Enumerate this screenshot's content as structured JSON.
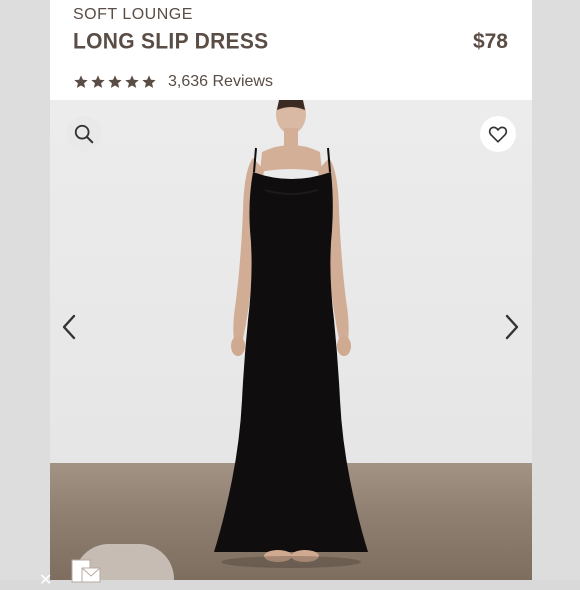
{
  "product": {
    "collection": "SOFT LOUNGE",
    "name": "LONG SLIP DRESS",
    "price": "$78",
    "rating": 5,
    "reviews": "3,636 Reviews"
  },
  "icons": {
    "search": "search-icon",
    "favorite": "heart-icon",
    "prev": "chevron-left-icon",
    "next": "chevron-right-icon",
    "close": "close-icon",
    "document": "document-icon"
  },
  "colors": {
    "text": "#5a4d45",
    "dress": "#0f0d0d",
    "floor": "#8f7f70"
  }
}
